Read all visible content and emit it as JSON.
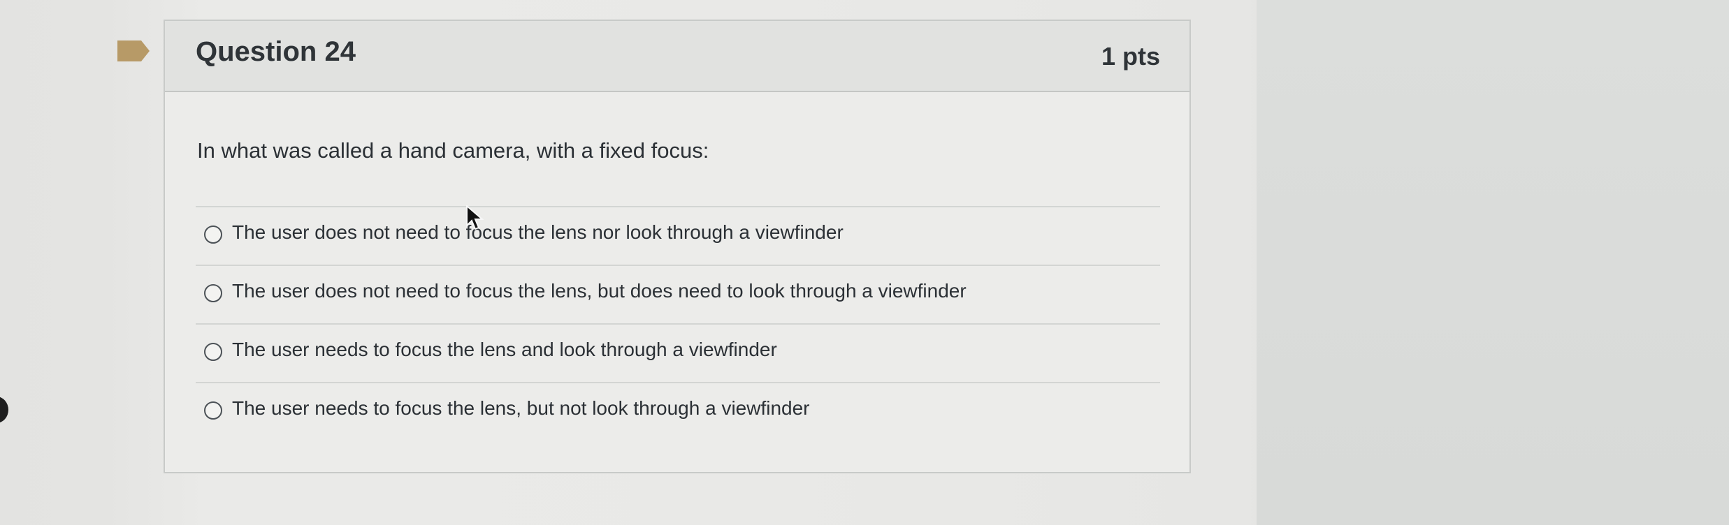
{
  "question": {
    "title": "Question 24",
    "points": "1 pts",
    "text": "In what was called a hand camera, with a fixed focus:",
    "flag_color": "#b79a67",
    "answers": [
      {
        "label": "The user does not need to focus the lens nor look through a viewfinder"
      },
      {
        "label": "The user does not need to focus the lens, but does need to look through a viewfinder"
      },
      {
        "label": "The user needs to focus the lens and look through a viewfinder"
      },
      {
        "label": "The user needs to focus the lens, but not look through a viewfinder"
      }
    ]
  },
  "icons": {
    "flag": "bookmark-flag-icon",
    "cursor": "mouse-pointer-icon"
  }
}
